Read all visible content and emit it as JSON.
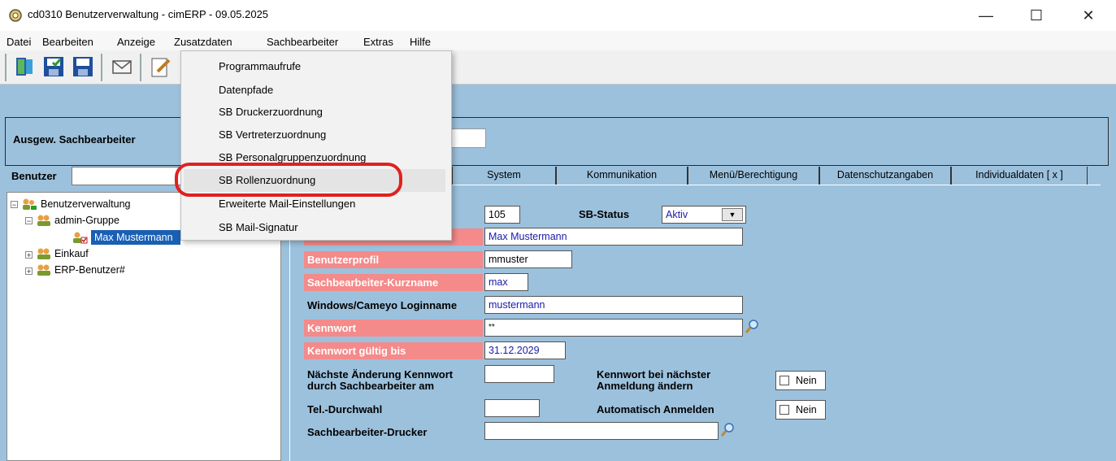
{
  "window": {
    "title": "cd0310 Benutzerverwaltung - cimERP - 09.05.2025",
    "minimize_glyph": "—",
    "maximize_glyph": "☐",
    "close_glyph": "✕"
  },
  "menu": {
    "items": [
      "Datei",
      "Bearbeiten",
      "Anzeige",
      "Zusatzdaten",
      "Sachbearbeiter",
      "Extras",
      "Hilfe"
    ]
  },
  "dropdown": {
    "items": [
      "Programmaufrufe",
      "Datenpfade",
      "SB Druckerzuordnung",
      "SB Vertreterzuordnung",
      "SB Personalgruppenzuordnung",
      "SB Rollenzuordnung",
      "Erweiterte Mail-Einstellungen",
      "SB Mail-Signatur"
    ],
    "highlighted_index": 5
  },
  "selection": {
    "label": "Ausgew. Sachbearbeiter",
    "value": ""
  },
  "search": {
    "label": "Benutzer",
    "value": ""
  },
  "tree": {
    "items": [
      {
        "label": "Benutzerverwaltung",
        "expander": "−"
      },
      {
        "label": "admin-Gruppe",
        "expander": "−"
      },
      {
        "label": "Max Mustermann",
        "expander": ""
      },
      {
        "label": "Einkauf",
        "expander": "+"
      },
      {
        "label": "ERP-Benutzer#",
        "expander": "+"
      }
    ],
    "selected_index": 2
  },
  "tabs": [
    "System",
    "Kommunikation",
    "Menü/Berechtigung",
    "Datenschutzangaben",
    "Individualdaten [ x ]"
  ],
  "form": {
    "id_value": "105",
    "status_label": "SB-Status",
    "status_value": "Aktiv",
    "name_value": "Max Mustermann",
    "profile_label": "Benutzerprofil",
    "profile_value": "mmuster",
    "shortname_label": "Sachbearbeiter-Kurzname",
    "shortname_value": "max",
    "login_label": "Windows/Cameyo Loginname",
    "login_value": "mustermann",
    "password_label": "Kennwort",
    "password_value": "**",
    "password_valid_label": "Kennwort gültig bis",
    "password_valid_value": "31.12.2029",
    "next_change_label_1": "Nächste Änderung Kennwort",
    "next_change_label_2": "durch Sachbearbeiter am",
    "next_change_value": "",
    "change_on_login_label_1": "Kennwort bei nächster",
    "change_on_login_label_2": "Anmeldung ändern",
    "change_on_login_value": "Nein",
    "phone_label": "Tel.-Durchwahl",
    "phone_value": "",
    "auto_login_label": "Automatisch Anmelden",
    "auto_login_value": "Nein",
    "printer_label": "Sachbearbeiter-Drucker",
    "printer_value": ""
  },
  "colors": {
    "background_blue": "#9cc1dd",
    "label_red": "#f48a8a",
    "selection_blue": "#1a5fb4",
    "annotation_red": "#e02020"
  }
}
